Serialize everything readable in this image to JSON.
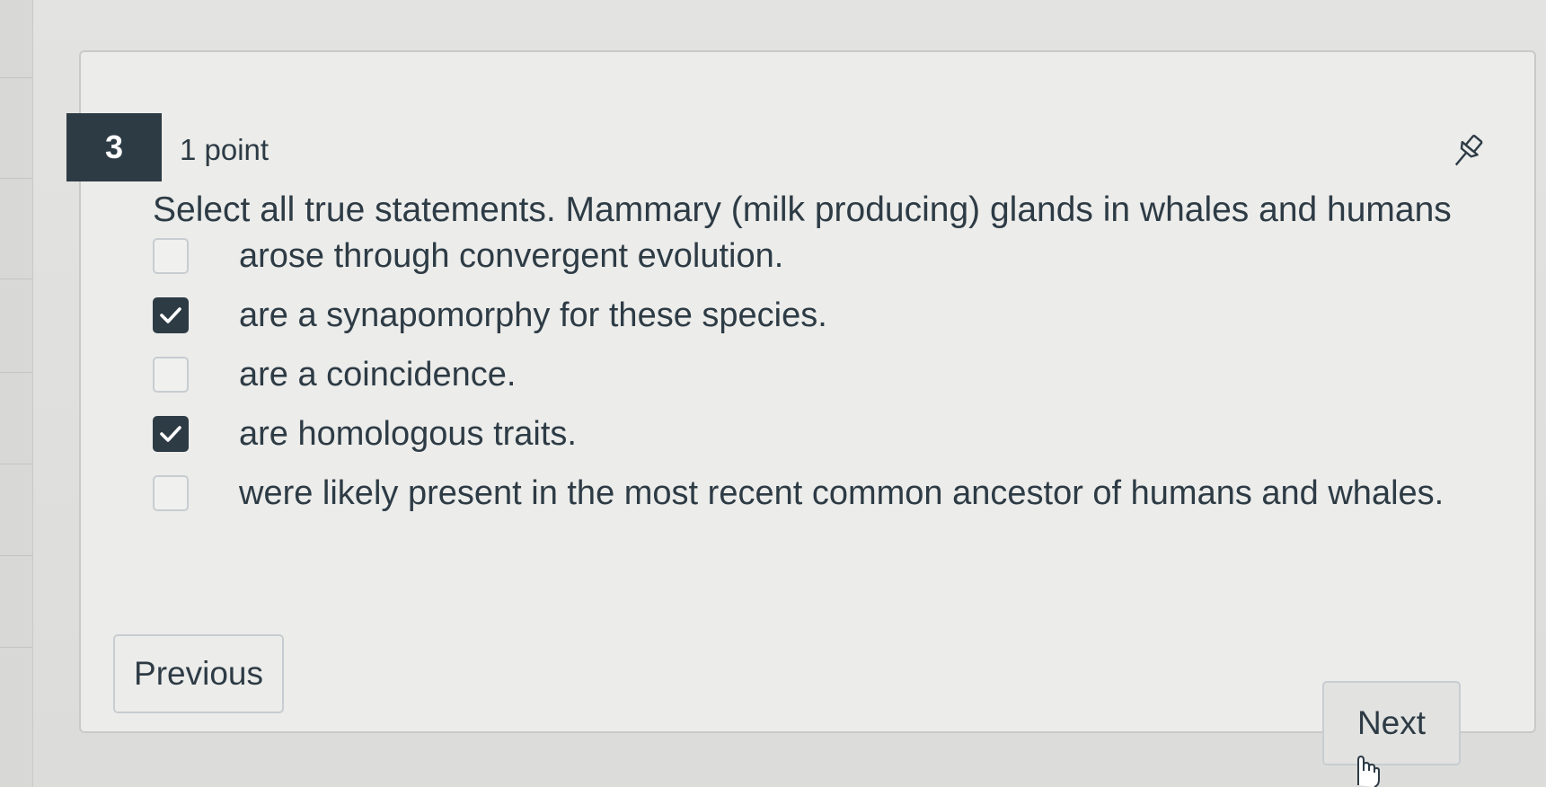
{
  "question": {
    "number": "3",
    "points": "1 point",
    "text": "Select all true statements. Mammary (milk producing) glands in whales and humans"
  },
  "options": [
    {
      "label": "arose through convergent evolution.",
      "checked": false
    },
    {
      "label": "are a synapomorphy for these species.",
      "checked": true
    },
    {
      "label": "are a coincidence.",
      "checked": false
    },
    {
      "label": "are homologous traits.",
      "checked": true
    },
    {
      "label": "were likely present in the most recent common ancestor of humans and whales.",
      "checked": false
    }
  ],
  "nav": {
    "previous_label": "Previous",
    "next_label": "Next"
  },
  "icons": {
    "pin": "pin-icon",
    "check": "checkmark-icon",
    "cursor": "hand-pointer-icon"
  },
  "colors": {
    "primary": "#2d3b45",
    "checkbox_border": "#c7cdd1",
    "card_bg": "#ececea"
  }
}
